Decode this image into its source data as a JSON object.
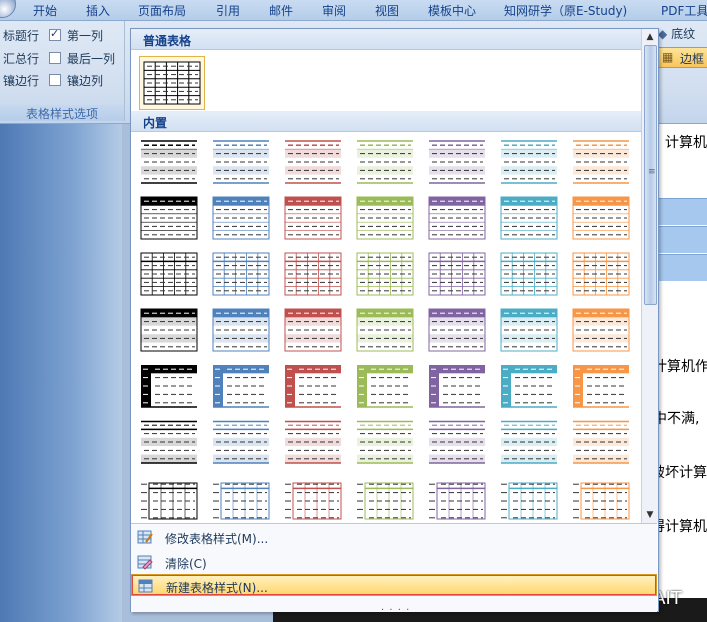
{
  "tabs": [
    "开始",
    "插入",
    "页面布局",
    "引用",
    "邮件",
    "审阅",
    "视图",
    "模板中心",
    "知网研学（原E-Study)",
    "PDF工具"
  ],
  "options_group": {
    "label": "表格样式选项",
    "items": [
      {
        "label": "标题行",
        "checked": true
      },
      {
        "label": "第一列",
        "checked": true
      },
      {
        "label": "汇总行",
        "checked": false
      },
      {
        "label": "最后一列",
        "checked": false
      },
      {
        "label": "镶边行",
        "checked": false
      },
      {
        "label": "镶边列",
        "checked": false
      }
    ]
  },
  "right_ribbon": {
    "shading_label": "底纹",
    "border_label": "边框"
  },
  "gallery": {
    "section_plain": "普通表格",
    "section_builtin": "内置",
    "palette": [
      "#000000",
      "#4f81bd",
      "#c0504d",
      "#9bbb59",
      "#8064a2",
      "#4bacc6",
      "#f79646"
    ],
    "tints": [
      "#d8d8d8",
      "#dbe5f1",
      "#f2dbdb",
      "#eaf1dd",
      "#e5e0ec",
      "#daeef3",
      "#fde9d9"
    ],
    "row_styles": [
      "light-shading",
      "light-list",
      "light-grid",
      "medium-shading",
      "medium-side",
      "medium-list",
      "header-lines"
    ]
  },
  "menu": {
    "modify": "修改表格样式(M)...",
    "clear": "清除(C)",
    "new_style": "新建表格样式(N)..."
  },
  "document": {
    "line1": "计算机",
    "line2": "计算机作",
    "line3": "中不满,",
    "line4": "破坏计算",
    "line5": "得计算机"
  },
  "watermark": "头条 @ATAIT"
}
